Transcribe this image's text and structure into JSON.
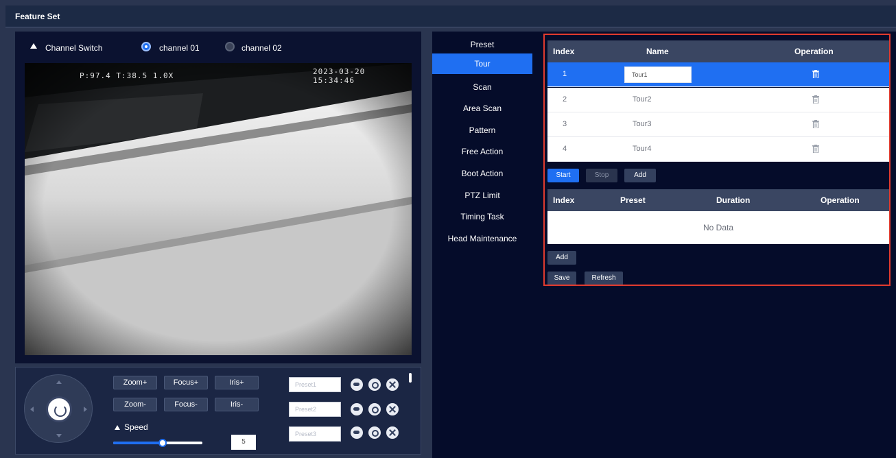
{
  "window": {
    "title": "Feature Set"
  },
  "channel_switch": {
    "label": "Channel Switch",
    "options": [
      {
        "label": "channel 01",
        "selected": true
      },
      {
        "label": "channel 02",
        "selected": false
      }
    ]
  },
  "video": {
    "osd_ptz": "P:97.4 T:38.5 1.0X",
    "osd_datetime": "2023-03-20 15:34:46"
  },
  "ptz_controls": {
    "zoom_in": "Zoom+",
    "zoom_out": "Zoom-",
    "focus_in": "Focus+",
    "focus_out": "Focus-",
    "iris_in": "Iris+",
    "iris_out": "Iris-",
    "speed_label": "Speed",
    "speed_value": "5",
    "speed_level": 0.55,
    "presets": [
      {
        "placeholder": "Preset1"
      },
      {
        "placeholder": "Preset2"
      },
      {
        "placeholder": "Preset3"
      }
    ]
  },
  "menu": {
    "items": [
      {
        "label": "Preset"
      },
      {
        "label": "Tour"
      },
      {
        "label": "Scan"
      },
      {
        "label": "Area Scan"
      },
      {
        "label": "Pattern"
      },
      {
        "label": "Free Action"
      },
      {
        "label": "Boot Action"
      },
      {
        "label": "PTZ Limit"
      },
      {
        "label": "Timing Task"
      },
      {
        "label": "Head Maintenance"
      }
    ],
    "active_index": 1
  },
  "tour_table": {
    "columns": [
      "Index",
      "Name",
      "Operation"
    ],
    "rows": [
      {
        "index": "1",
        "name": "Tour1"
      },
      {
        "index": "2",
        "name": "Tour2"
      },
      {
        "index": "3",
        "name": "Tour3"
      },
      {
        "index": "4",
        "name": "Tour4"
      }
    ],
    "selected_index": 0
  },
  "tour_actions": {
    "start": "Start",
    "stop": "Stop",
    "add": "Add"
  },
  "preset_table": {
    "columns": [
      "Index",
      "Preset",
      "Duration",
      "Operation"
    ],
    "empty_text": "No Data"
  },
  "bottom_actions": {
    "add": "Add",
    "save": "Save",
    "refresh": "Refresh"
  },
  "colors": {
    "accent": "#1f6ff2",
    "highlight_box": "#e23b2e",
    "panel_bg": "#050c2a"
  }
}
